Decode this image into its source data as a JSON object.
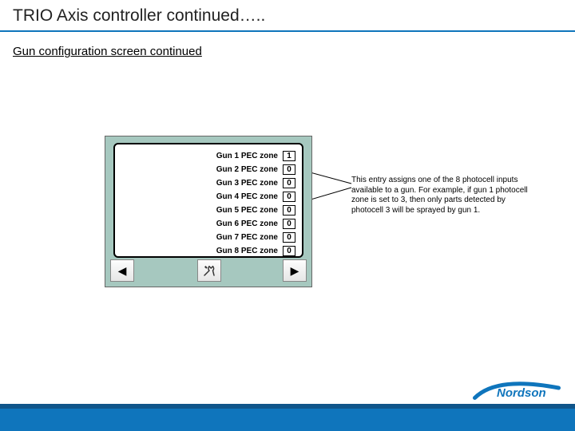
{
  "title": "TRIO Axis controller continued…..",
  "subtitle": "Gun configuration screen continued",
  "rows": [
    {
      "label": "Gun 1 PEC zone",
      "value": "1"
    },
    {
      "label": "Gun 2 PEC zone",
      "value": "0"
    },
    {
      "label": "Gun 3 PEC zone",
      "value": "0"
    },
    {
      "label": "Gun 4 PEC zone",
      "value": "0"
    },
    {
      "label": "Gun 5 PEC zone",
      "value": "0"
    },
    {
      "label": "Gun 6 PEC zone",
      "value": "0"
    },
    {
      "label": "Gun 7 PEC zone",
      "value": "0"
    },
    {
      "label": "Gun 8 PEC zone",
      "value": "0"
    }
  ],
  "nav": {
    "left": "◀",
    "right": "▶"
  },
  "annotation": "This entry assigns one of the 8 photocell inputs available to a gun. For example, if gun 1 photocell zone is set to 3, then only parts detected by photocell 3 will be sprayed by gun 1.",
  "logo_text": "Nordson"
}
